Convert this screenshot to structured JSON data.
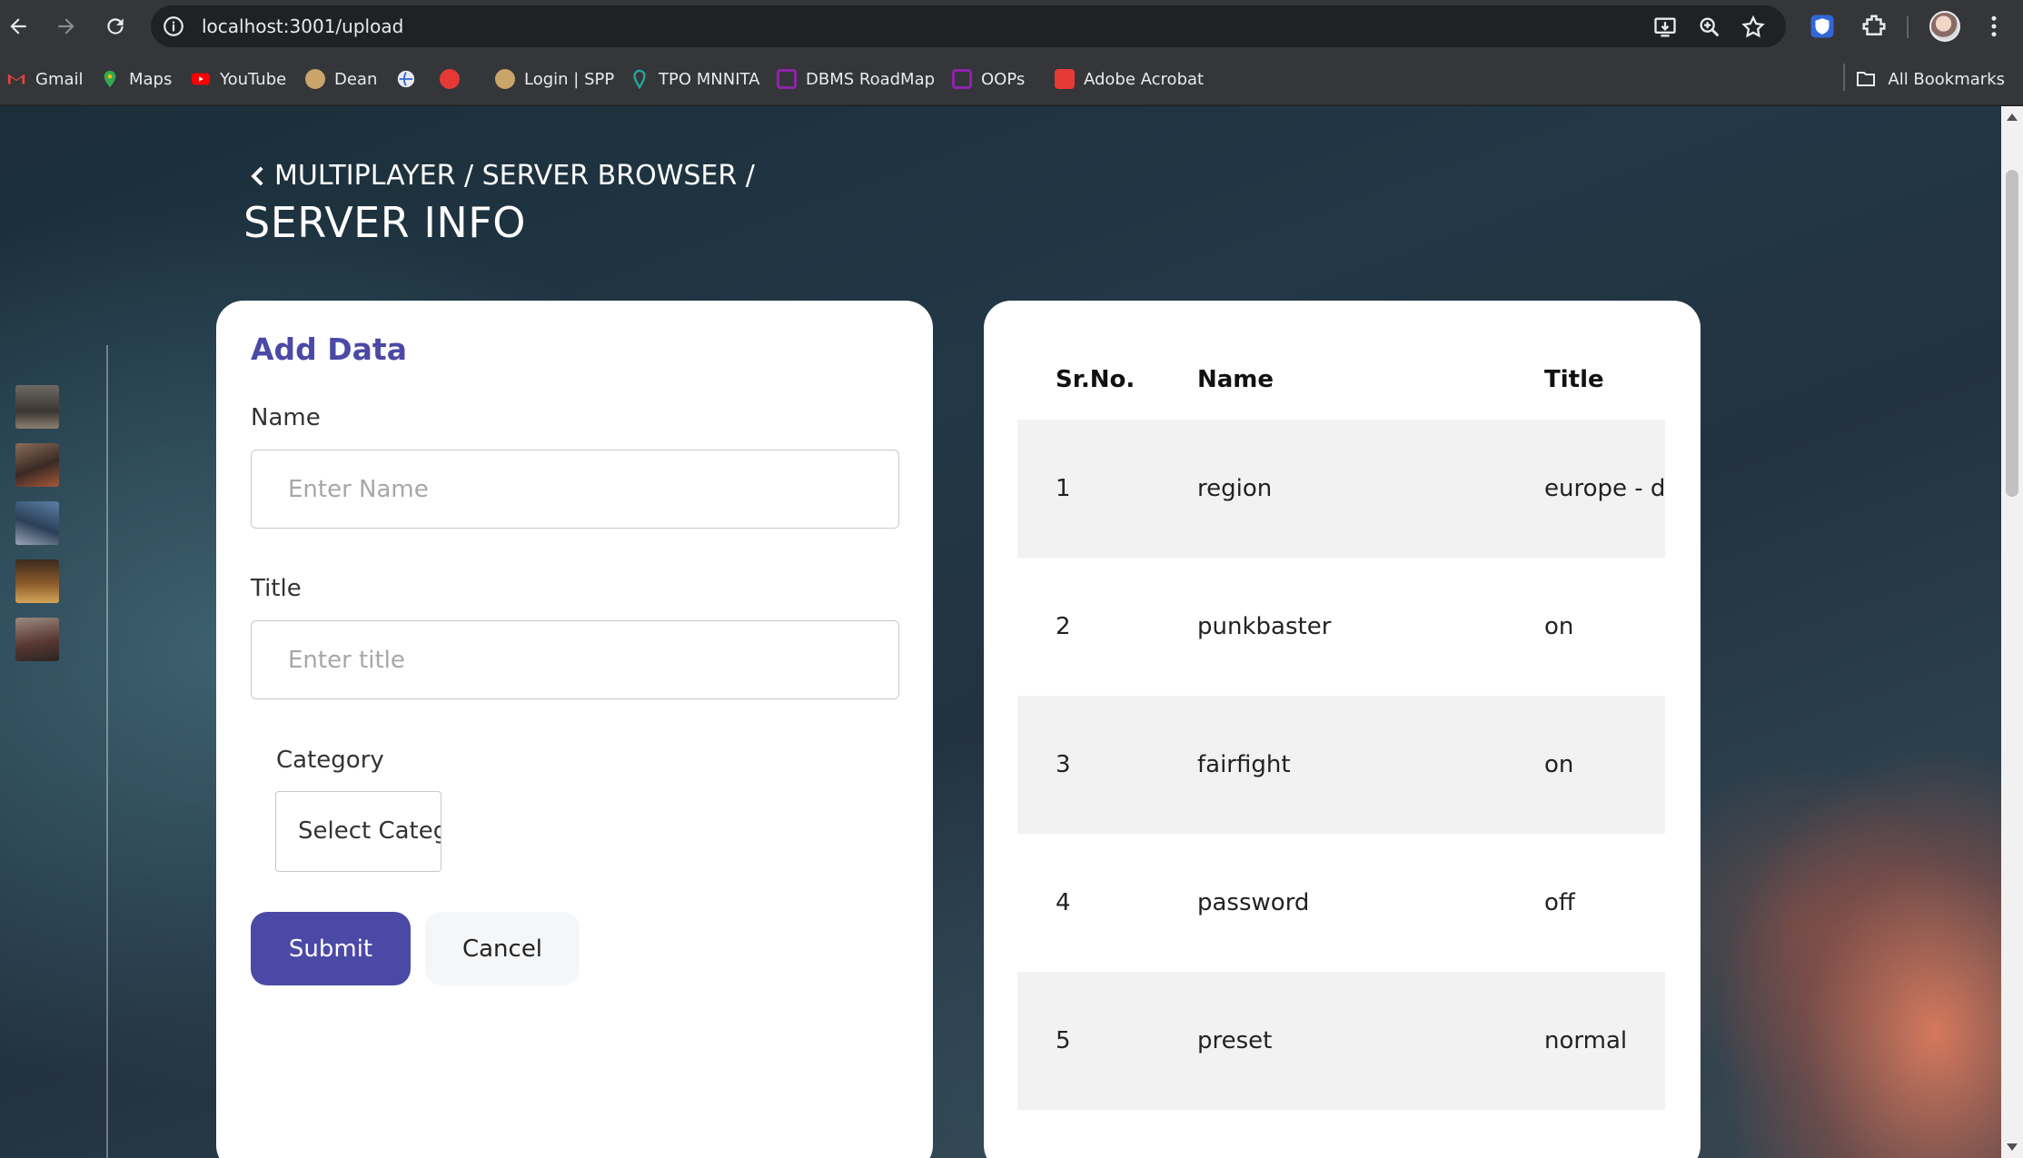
{
  "browser": {
    "url": "localhost:3001/upload",
    "bookmarks": [
      {
        "label": "Gmail",
        "icon": "gmail-icon",
        "color": "#ea4335"
      },
      {
        "label": "Maps",
        "icon": "maps-icon",
        "color": "#34a853"
      },
      {
        "label": "YouTube",
        "icon": "youtube-icon",
        "color": "#ff0000"
      },
      {
        "label": "Dean",
        "icon": "dean-icon",
        "color": "#c9a56a"
      },
      {
        "label": "",
        "icon": "globe-icon",
        "color": "#e8eaed"
      },
      {
        "label": "",
        "icon": "tuf-icon",
        "color": "#e53935"
      },
      {
        "label": "Login | SPP",
        "icon": "spp-icon",
        "color": "#c9a56a"
      },
      {
        "label": "TPO MNNITA",
        "icon": "tpo-icon",
        "color": "#26a69a"
      },
      {
        "label": "DBMS RoadMap",
        "icon": "roadmap-icon",
        "color": "#8e24aa"
      },
      {
        "label": "OOPs",
        "icon": "roadmap-icon",
        "color": "#8e24aa"
      },
      {
        "label": "Adobe Acrobat",
        "icon": "acrobat-icon",
        "color": "#e53935"
      }
    ],
    "all_bookmarks": "All Bookmarks"
  },
  "header": {
    "breadcrumb": "MULTIPLAYER / SERVER BROWSER /",
    "title": "SERVER INFO"
  },
  "form": {
    "heading": "Add Data",
    "name_label": "Name",
    "name_placeholder": "Enter Name",
    "title_label": "Title",
    "title_placeholder": "Enter title",
    "category_label": "Category",
    "category_selected": "Select Category",
    "submit_label": "Submit",
    "cancel_label": "Cancel"
  },
  "table": {
    "columns": [
      "Sr.No.",
      "Name",
      "Title"
    ],
    "rows": [
      {
        "sr": "1",
        "name": "region",
        "title": "europe - de"
      },
      {
        "sr": "2",
        "name": "punkbaster",
        "title": "on"
      },
      {
        "sr": "3",
        "name": "fairfight",
        "title": "on"
      },
      {
        "sr": "4",
        "name": "password",
        "title": "off"
      },
      {
        "sr": "5",
        "name": "preset",
        "title": "normal"
      }
    ]
  },
  "colors": {
    "accent": "#4b49a6",
    "row_shade": "#f2f2f2"
  }
}
